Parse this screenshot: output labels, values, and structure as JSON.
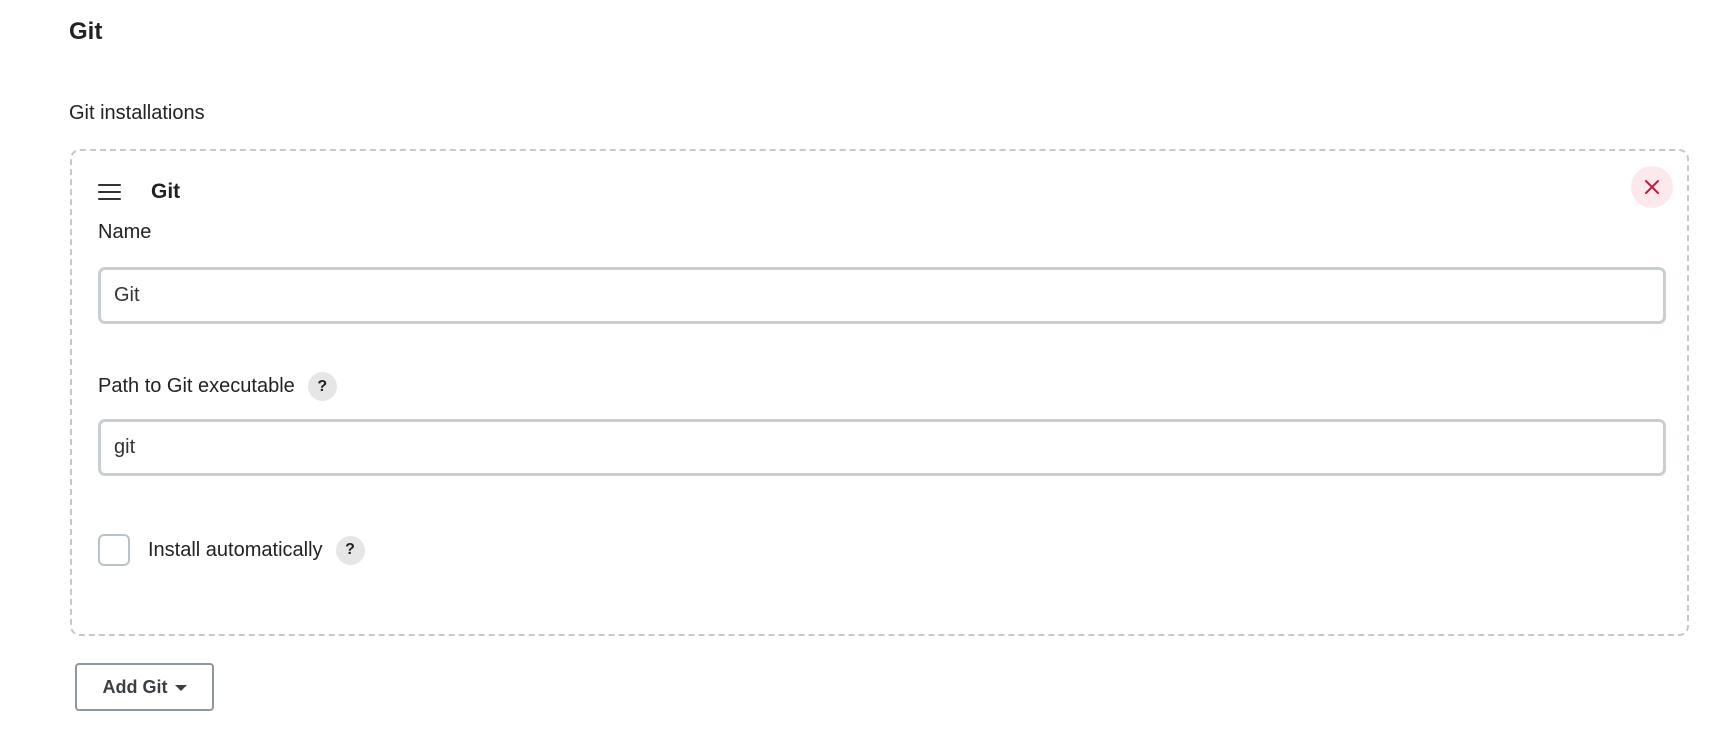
{
  "section": {
    "title": "Git",
    "installations_label": "Git installations"
  },
  "installation": {
    "title": "Git",
    "name_label": "Name",
    "name_value": "Git",
    "path_label": "Path to Git executable",
    "path_value": "git",
    "install_auto_label": "Install automatically",
    "install_auto_checked": false,
    "help_glyph": "?"
  },
  "add_button": {
    "label": "Add Git"
  },
  "icons": {
    "drag": "drag-handle-icon",
    "delete": "close-icon",
    "help": "help-icon",
    "caret": "caret-down-icon"
  },
  "colors": {
    "delete_bg": "#fde8ec",
    "delete_icon": "#c4163f",
    "chunk_border": "#c2c9ce",
    "input_border": "#c8cfd3"
  }
}
